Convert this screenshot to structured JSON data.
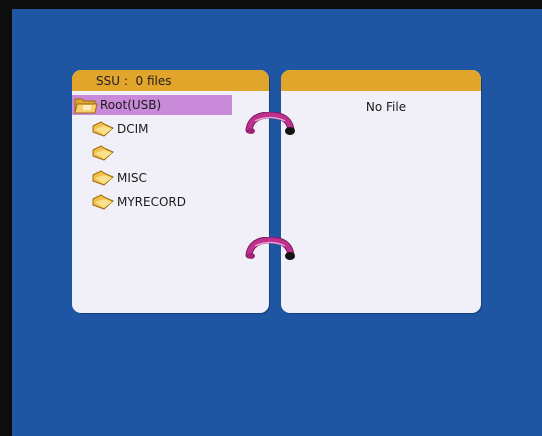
{
  "browser": {
    "left_panel": {
      "header": "SSU :  0 files",
      "root": {
        "label": "Root(USB)",
        "icon": "open-folder-icon",
        "selected": true
      },
      "folders": [
        {
          "label": "DCIM",
          "icon": "folder-icon"
        },
        {
          "label": "",
          "icon": "folder-icon"
        },
        {
          "label": "MISC",
          "icon": "folder-icon"
        },
        {
          "label": "MYRECORD",
          "icon": "folder-icon"
        }
      ]
    },
    "right_panel": {
      "message": "No File"
    },
    "colors": {
      "background": "#1f56a3",
      "panel": "#f1f0f8",
      "header": "#e0a52a",
      "selection": "#c88ad9",
      "ring": "#c0308f"
    }
  }
}
